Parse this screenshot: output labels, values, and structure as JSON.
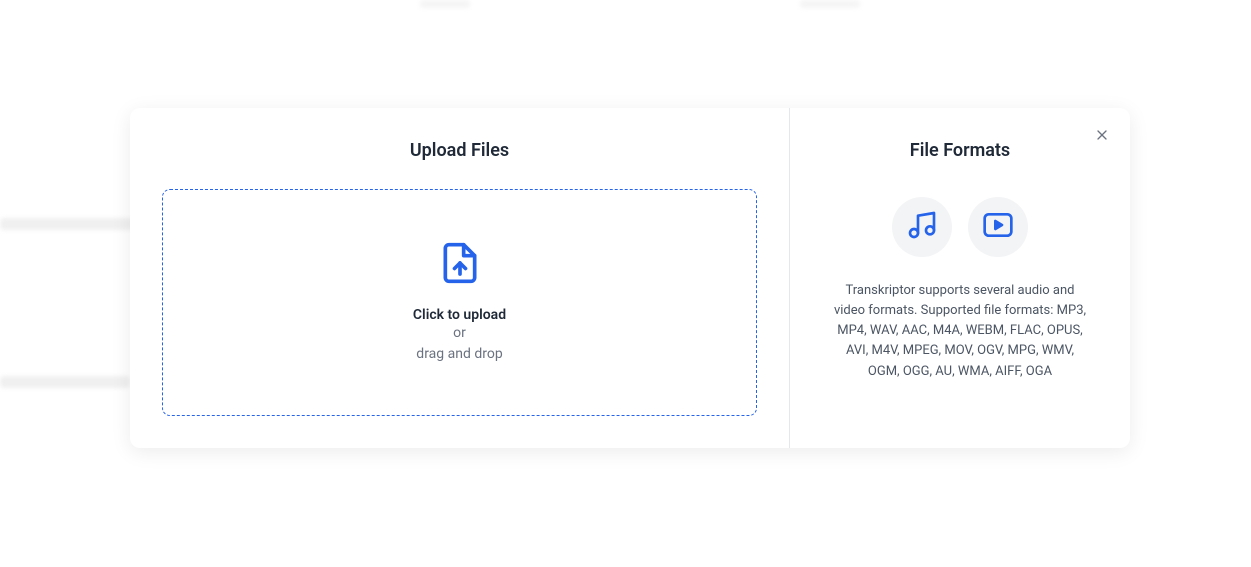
{
  "upload": {
    "title": "Upload Files",
    "primary_text": "Click to upload",
    "or_text": "or",
    "secondary_text": "drag and drop"
  },
  "formats": {
    "title": "File Formats",
    "description": "Transkriptor supports several audio and video formats. Supported file formats: MP3, MP4, WAV, AAC, M4A, WEBM, FLAC, OPUS, AVI, M4V, MPEG, MOV, OGV, MPG, WMV, OGM, OGG, AU, WMA, AIFF, OGA"
  },
  "colors": {
    "accent": "#2563eb",
    "text_primary": "#1f2937",
    "text_secondary": "#6b7280"
  }
}
